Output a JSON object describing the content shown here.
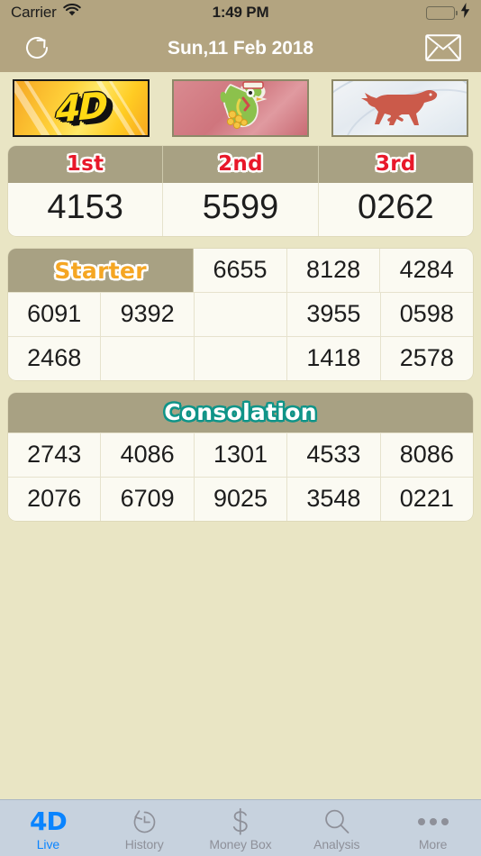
{
  "status_bar": {
    "carrier": "Carrier",
    "wifi_icon": "wifi-icon",
    "time": "1:49 PM",
    "battery_icon": "battery-full-icon",
    "charging_icon": "lightning-bolt-icon",
    "battery_color": "#4cd964"
  },
  "nav": {
    "refresh_icon": "refresh-icon",
    "title": "Sun,11 Feb 2018",
    "mail_icon": "envelope-icon",
    "bar_color": "#b3a480"
  },
  "operators": [
    {
      "name": "magnum-4d",
      "label": "4D",
      "accent": "#ffd914"
    },
    {
      "name": "damacai",
      "label": "",
      "accent": "#cf757d"
    },
    {
      "name": "sports-toto-horse",
      "label": "",
      "accent": "#cb5a4a"
    }
  ],
  "top_prizes": {
    "headers": [
      "1st",
      "2nd",
      "3rd"
    ],
    "values": [
      "4153",
      "5599",
      "0262"
    ],
    "header_color": "#e8182a"
  },
  "starter": {
    "title": "Starter",
    "title_color": "#f5a623",
    "rows": [
      [
        "",
        "6655",
        "8128",
        "4284"
      ],
      [
        "6091",
        "9392",
        "",
        "3955",
        "0598"
      ],
      [
        "2468",
        "",
        "",
        "1418",
        "2578"
      ]
    ]
  },
  "consolation": {
    "title": "Consolation",
    "title_color": "#ffffff",
    "outline_color": "#0f9488",
    "rows": [
      [
        "2743",
        "4086",
        "1301",
        "4533",
        "8086"
      ],
      [
        "2076",
        "6709",
        "9025",
        "3548",
        "0221"
      ]
    ]
  },
  "tab_bar": {
    "active_color": "#0a84ff",
    "items": [
      {
        "icon": "four-d-icon",
        "label": "Live",
        "glyph": "4D",
        "active": true
      },
      {
        "icon": "history-clock-icon",
        "label": "History",
        "active": false
      },
      {
        "icon": "dollar-sign-icon",
        "label": "Money Box",
        "active": false
      },
      {
        "icon": "magnifier-icon",
        "label": "Analysis",
        "active": false
      },
      {
        "icon": "ellipsis-icon",
        "label": "More",
        "active": false
      }
    ]
  }
}
